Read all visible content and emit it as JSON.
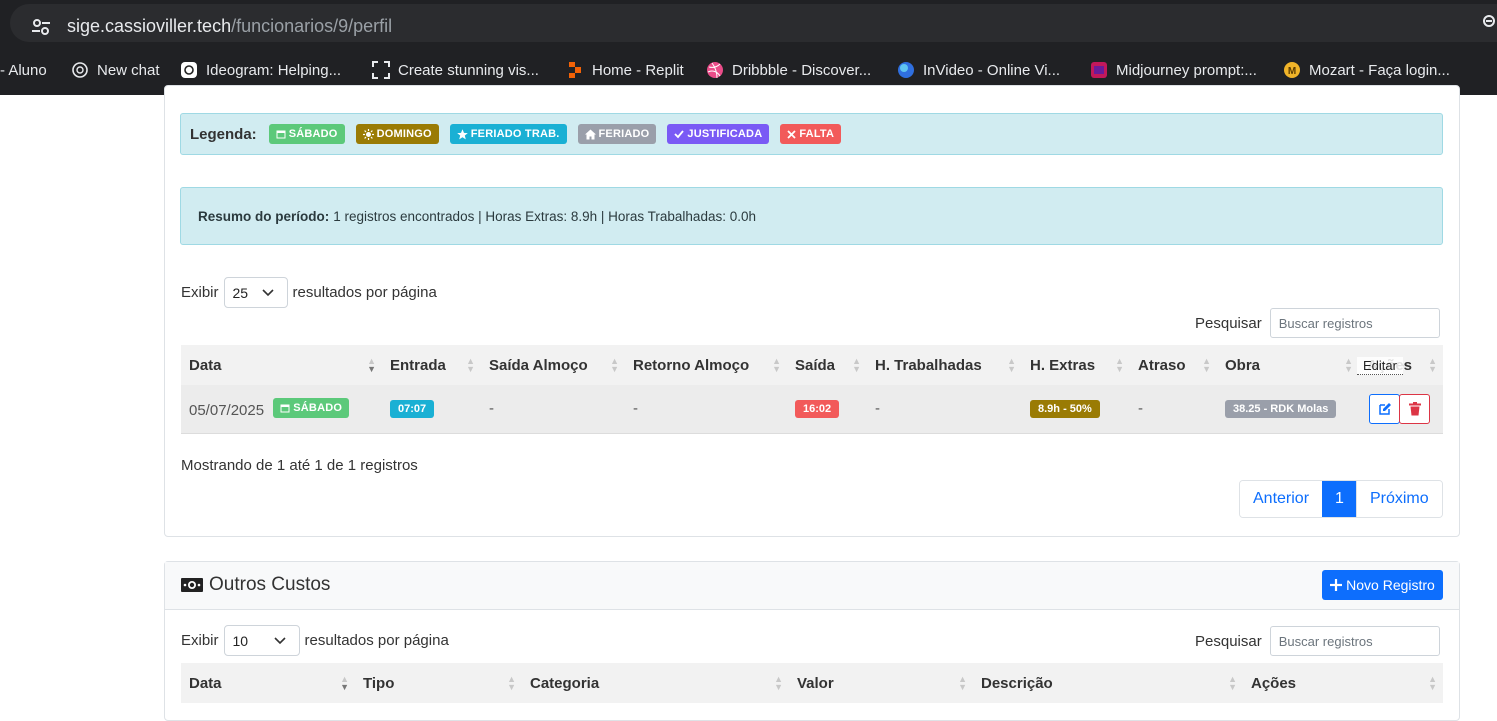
{
  "browser": {
    "url_host": "sige.cassioviller.tech",
    "url_path": "/funcionarios/9/perfil",
    "bookmarks": [
      {
        "label": "- Aluno",
        "icon": "none"
      },
      {
        "label": "New chat",
        "icon": "openai-icon"
      },
      {
        "label": "Ideogram: Helping...",
        "icon": "ideogram-icon"
      },
      {
        "label": "Create stunning vis...",
        "icon": "frame-icon"
      },
      {
        "label": "Home - Replit",
        "icon": "replit-icon"
      },
      {
        "label": "Dribbble - Discover...",
        "icon": "dribbble-icon"
      },
      {
        "label": "InVideo - Online Vi...",
        "icon": "invideo-icon"
      },
      {
        "label": "Midjourney prompt:...",
        "icon": "midjourney-icon"
      },
      {
        "label": "Mozart - Faça login...",
        "icon": "mozart-icon"
      }
    ]
  },
  "legend": {
    "title": "Legenda:",
    "items": [
      {
        "label": "SÁBADO",
        "color": "#5cc97a",
        "icon": "calendar-icon"
      },
      {
        "label": "DOMINGO",
        "color": "#9a7b04",
        "icon": "sun-icon"
      },
      {
        "label": "FERIADO TRAB.",
        "color": "#1ab0d4",
        "icon": "star-icon"
      },
      {
        "label": "FERIADO",
        "color": "#9a9faa",
        "icon": "home-icon"
      },
      {
        "label": "JUSTIFICADA",
        "color": "#7a5af5",
        "icon": "check-icon"
      },
      {
        "label": "FALTA",
        "color": "#f25a5a",
        "icon": "x-icon"
      }
    ]
  },
  "summary": {
    "label": "Resumo do período:",
    "text": "1 registros encontrados | Horas Extras: 8.9h | Horas Trabalhadas: 0.0h"
  },
  "table1": {
    "length_prefix": "Exibir",
    "length_value": "25",
    "length_suffix": "resultados por página",
    "search_label": "Pesquisar",
    "search_placeholder": "Buscar registros",
    "headers": [
      "Data",
      "Entrada",
      "Saída Almoço",
      "Retorno Almoço",
      "Saída",
      "H. Trabalhadas",
      "H. Extras",
      "Atraso",
      "Obra",
      "Ações"
    ],
    "row": {
      "data": "05/07/2025",
      "data_badge": "SÁBADO",
      "entrada": "07:07",
      "saida_almoco": "-",
      "retorno_almoco": "-",
      "saida": "16:02",
      "h_trabalhadas": "-",
      "h_extras": "8.9h - 50%",
      "atraso": "-",
      "obra": "38.25 - RDK Molas"
    },
    "tooltip": "Editar",
    "info": "Mostrando de 1 até 1 de 1 registros",
    "pager": {
      "prev": "Anterior",
      "current": "1",
      "next": "Próximo"
    },
    "colors": {
      "entrada": "#1ab0d4",
      "saida": "#f25a5a",
      "extras": "#9a7b04",
      "obra": "#9a9faa",
      "edit": "#0d6efd",
      "delete": "#dc3545"
    }
  },
  "card2": {
    "title": "Outros Custos",
    "new_button": "Novo Registro",
    "length_prefix": "Exibir",
    "length_value": "10",
    "length_suffix": "resultados por página",
    "search_label": "Pesquisar",
    "search_placeholder": "Buscar registros",
    "headers": [
      "Data",
      "Tipo",
      "Categoria",
      "Valor",
      "Descrição",
      "Ações"
    ]
  }
}
